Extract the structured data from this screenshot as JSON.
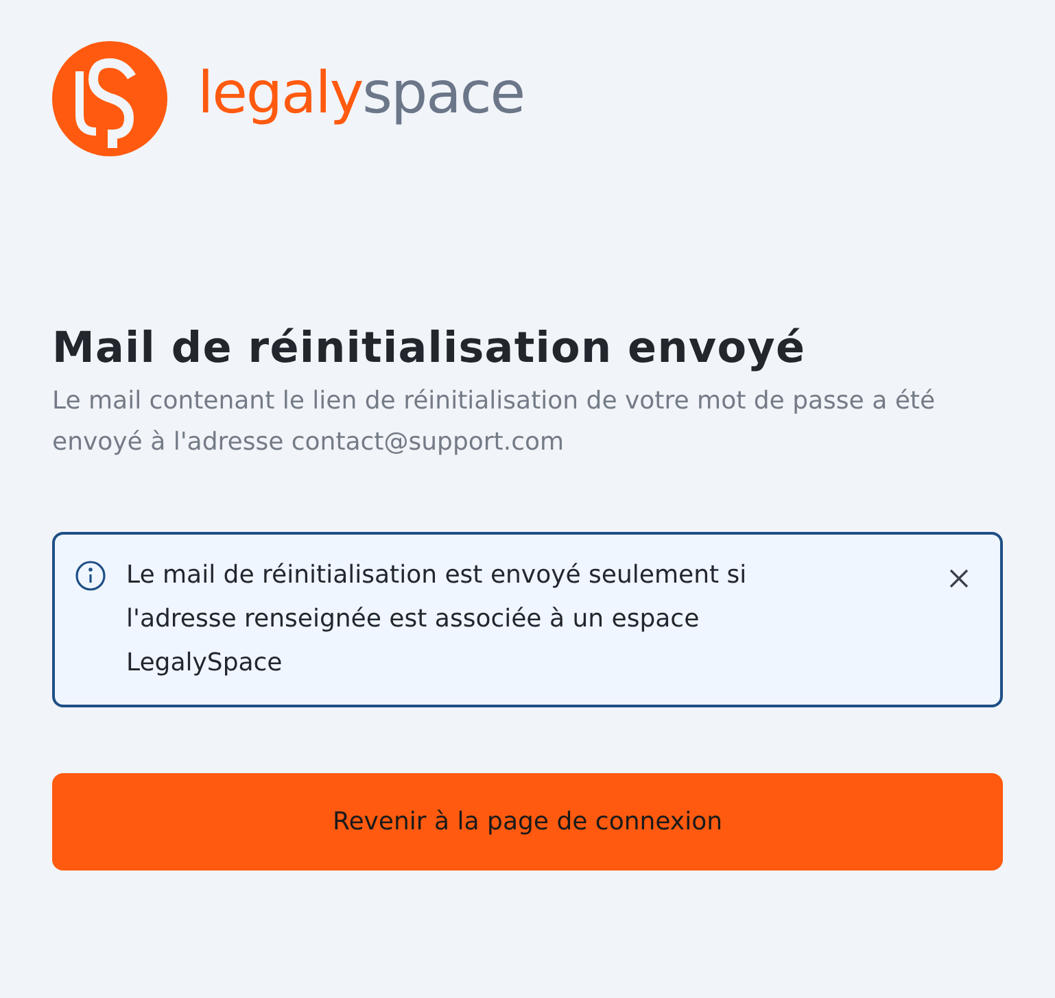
{
  "logo": {
    "word_first": "legaly",
    "word_second": "space"
  },
  "heading": "Mail de réinitialisation envoyé",
  "description": "Le mail contenant le lien de réinitialisation de votre mot de passe a été envoyé à l'adresse contact@support.com",
  "alert": {
    "message": "Le mail de réinitialisation est envoyé seulement si l'adresse renseignée est associée à un espace LegalySpace"
  },
  "button": {
    "label": "Revenir à la page de connexion"
  }
}
